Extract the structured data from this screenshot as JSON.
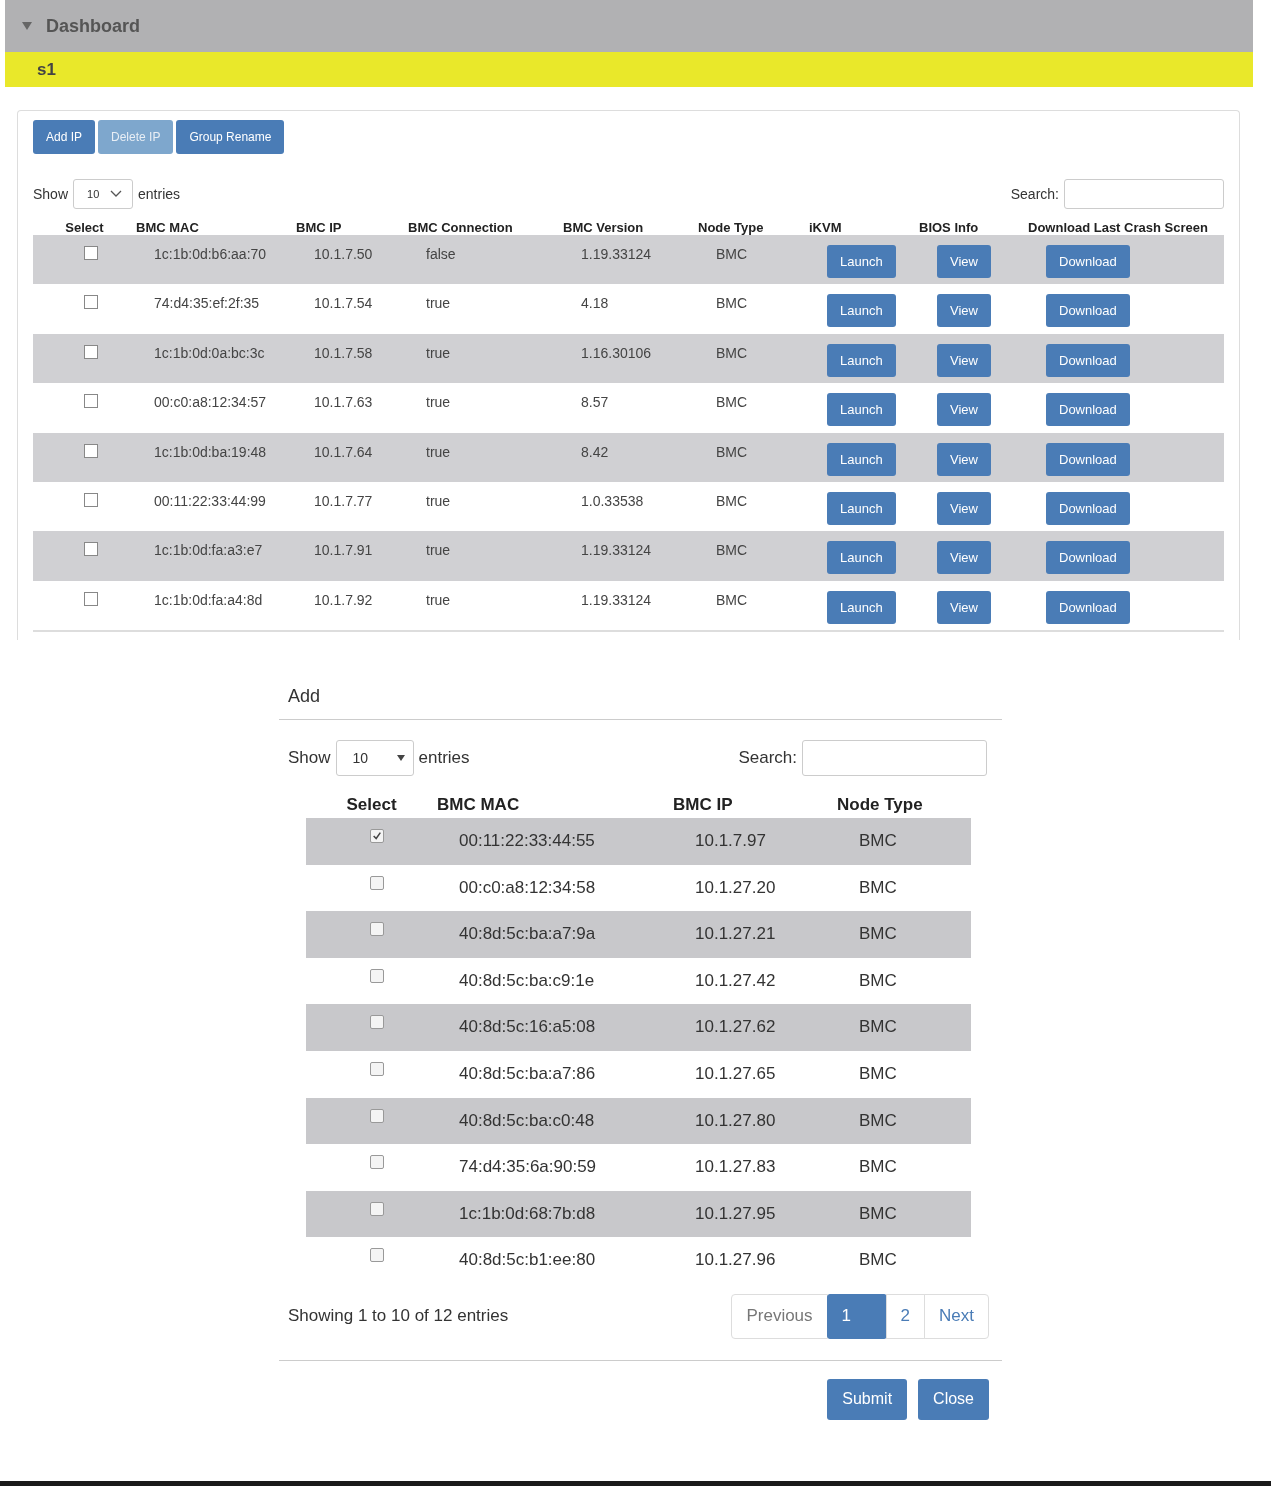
{
  "header": {
    "title": "Dashboard",
    "expanded": true
  },
  "group": {
    "name": "s1"
  },
  "toolbar": [
    {
      "label": "Add IP",
      "disabled": false
    },
    {
      "label": "Delete IP",
      "disabled": true
    },
    {
      "label": "Group Rename",
      "disabled": false
    }
  ],
  "length_menu": {
    "before": "Show",
    "value": "10",
    "after": "entries"
  },
  "search": {
    "label": "Search:"
  },
  "table": {
    "columns": [
      "Select",
      "BMC MAC",
      "BMC IP",
      "BMC Connection",
      "BMC Version",
      "Node Type",
      "iKVM",
      "BIOS Info",
      "Download Last Crash Screen"
    ],
    "rows": [
      {
        "checked": false,
        "mac": "1c:1b:0d:b6:aa:70",
        "ip": "10.1.7.50",
        "connection": "false",
        "version": "1.19.33124",
        "node_type": "BMC",
        "ikvm": "Launch",
        "bios": "View",
        "download": "Download"
      },
      {
        "checked": false,
        "mac": "74:d4:35:ef:2f:35",
        "ip": "10.1.7.54",
        "connection": "true",
        "version": "4.18",
        "node_type": "BMC",
        "ikvm": "Launch",
        "bios": "View",
        "download": "Download"
      },
      {
        "checked": false,
        "mac": "1c:1b:0d:0a:bc:3c",
        "ip": "10.1.7.58",
        "connection": "true",
        "version": "1.16.30106",
        "node_type": "BMC",
        "ikvm": "Launch",
        "bios": "View",
        "download": "Download"
      },
      {
        "checked": false,
        "mac": "00:c0:a8:12:34:57",
        "ip": "10.1.7.63",
        "connection": "true",
        "version": "8.57",
        "node_type": "BMC",
        "ikvm": "Launch",
        "bios": "View",
        "download": "Download"
      },
      {
        "checked": false,
        "mac": "1c:1b:0d:ba:19:48",
        "ip": "10.1.7.64",
        "connection": "true",
        "version": "8.42",
        "node_type": "BMC",
        "ikvm": "Launch",
        "bios": "View",
        "download": "Download"
      },
      {
        "checked": false,
        "mac": "00:11:22:33:44:99",
        "ip": "10.1.7.77",
        "connection": "true",
        "version": "1.0.33538",
        "node_type": "BMC",
        "ikvm": "Launch",
        "bios": "View",
        "download": "Download"
      },
      {
        "checked": false,
        "mac": "1c:1b:0d:fa:a3:e7",
        "ip": "10.1.7.91",
        "connection": "true",
        "version": "1.19.33124",
        "node_type": "BMC",
        "ikvm": "Launch",
        "bios": "View",
        "download": "Download"
      },
      {
        "checked": false,
        "mac": "1c:1b:0d:fa:a4:8d",
        "ip": "10.1.7.92",
        "connection": "true",
        "version": "1.19.33124",
        "node_type": "BMC",
        "ikvm": "Launch",
        "bios": "View",
        "download": "Download"
      }
    ]
  },
  "dialog": {
    "title": "Add",
    "length_menu": {
      "before": "Show",
      "value": "10",
      "after": "entries"
    },
    "search": {
      "label": "Search:"
    },
    "columns": [
      "Select",
      "BMC MAC",
      "BMC IP",
      "Node Type"
    ],
    "rows": [
      {
        "checked": true,
        "mac": "00:11:22:33:44:55",
        "ip": "10.1.7.97",
        "node_type": "BMC"
      },
      {
        "checked": false,
        "mac": "00:c0:a8:12:34:58",
        "ip": "10.1.27.20",
        "node_type": "BMC"
      },
      {
        "checked": false,
        "mac": "40:8d:5c:ba:a7:9a",
        "ip": "10.1.27.21",
        "node_type": "BMC"
      },
      {
        "checked": false,
        "mac": "40:8d:5c:ba:c9:1e",
        "ip": "10.1.27.42",
        "node_type": "BMC"
      },
      {
        "checked": false,
        "mac": "40:8d:5c:16:a5:08",
        "ip": "10.1.27.62",
        "node_type": "BMC"
      },
      {
        "checked": false,
        "mac": "40:8d:5c:ba:a7:86",
        "ip": "10.1.27.65",
        "node_type": "BMC"
      },
      {
        "checked": false,
        "mac": "40:8d:5c:ba:c0:48",
        "ip": "10.1.27.80",
        "node_type": "BMC"
      },
      {
        "checked": false,
        "mac": "74:d4:35:6a:90:59",
        "ip": "10.1.27.83",
        "node_type": "BMC"
      },
      {
        "checked": false,
        "mac": "1c:1b:0d:68:7b:d8",
        "ip": "10.1.27.95",
        "node_type": "BMC"
      },
      {
        "checked": false,
        "mac": "40:8d:5c:b1:ee:80",
        "ip": "10.1.27.96",
        "node_type": "BMC"
      }
    ],
    "info": "Showing 1 to 10 of 12 entries",
    "pagination": [
      {
        "label": "Previous",
        "selected": false
      },
      {
        "label": "1",
        "selected": true
      },
      {
        "label": "2",
        "selected": false
      },
      {
        "label": "Next",
        "selected": false
      }
    ],
    "buttons": [
      "Submit",
      "Close"
    ]
  }
}
